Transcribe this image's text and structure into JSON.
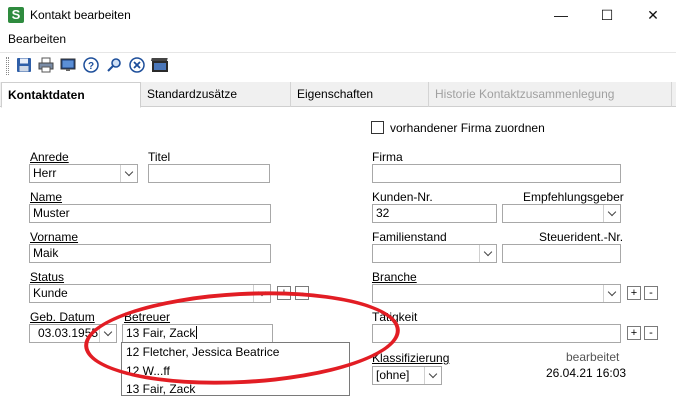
{
  "window": {
    "title": "Kontakt bearbeiten",
    "logo_letter": "S",
    "controls": [
      "—",
      "☐",
      "✕"
    ]
  },
  "menu": {
    "items": [
      "Bearbeiten"
    ]
  },
  "toolbar": {
    "icons": [
      "save-icon",
      "print-icon",
      "monitor-icon",
      "help-icon",
      "search-icon",
      "cancel-icon",
      "film-icon"
    ]
  },
  "tabs": [
    {
      "label": "Kontaktdaten",
      "state": "active"
    },
    {
      "label": "Standardzusätze",
      "state": "normal"
    },
    {
      "label": "Eigenschaften",
      "state": "normal"
    },
    {
      "label": "Historie Kontaktzusammenlegung",
      "state": "disabled"
    }
  ],
  "form": {
    "vorhandene_firma": {
      "label": "vorhandener Firma zuordnen",
      "checked": false
    },
    "anrede": {
      "label": "Anrede",
      "value": "Herr"
    },
    "titel": {
      "label": "Titel",
      "value": ""
    },
    "name": {
      "label": "Name",
      "value": "Muster"
    },
    "vorname": {
      "label": "Vorname",
      "value": "Maik"
    },
    "status": {
      "label": "Status",
      "value": "Kunde"
    },
    "geb_datum": {
      "label": "Geb. Datum",
      "value": "03.03.1955"
    },
    "betreuer": {
      "label": "Betreuer",
      "value": "13 Fair, Zack"
    },
    "firma": {
      "label": "Firma",
      "value": ""
    },
    "kunden_nr": {
      "label": "Kunden-Nr.",
      "value": "32"
    },
    "empfehlungsgeber": {
      "label": "Empfehlungsgeber",
      "value": ""
    },
    "familienstand": {
      "label": "Familienstand",
      "value": ""
    },
    "steuerident": {
      "label": "Steuerident.-Nr.",
      "value": ""
    },
    "branche": {
      "label": "Branche",
      "value": ""
    },
    "taetigkeit": {
      "label": "Tätigkeit",
      "value": ""
    },
    "klassifizierung": {
      "label": "Klassifizierung",
      "value": "[ohne]"
    },
    "bearbeitet": {
      "label": "bearbeitet",
      "value": "26.04.21 16:03"
    },
    "plus": "+",
    "minus": "-"
  },
  "betreuer_dropdown": {
    "items": [
      "12 Fletcher, Jessica Beatrice",
      "12 W...ff",
      "13 Fair, Zack"
    ]
  },
  "colors": {
    "annotation_ellipse": "#e21d24",
    "logo_green": "#2e8b3e"
  }
}
